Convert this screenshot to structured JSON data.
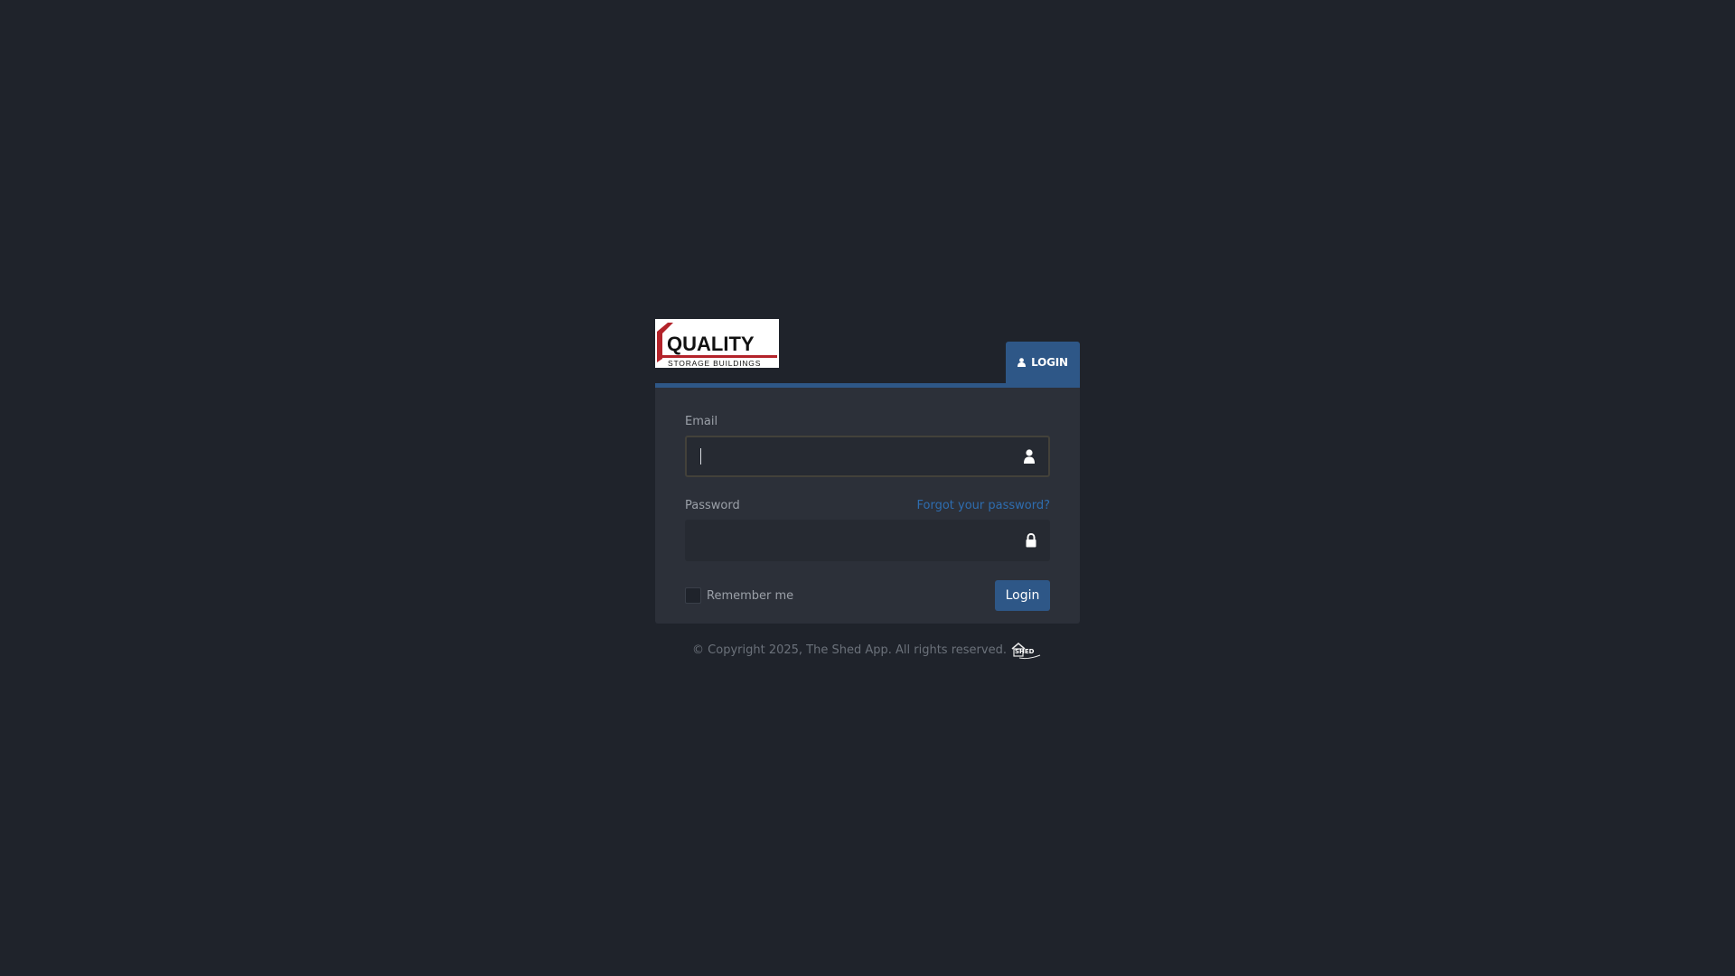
{
  "logo": {
    "line1": "QUALITY",
    "line2": "STORAGE BUILDINGS"
  },
  "tab": {
    "label": "LOGIN",
    "icon": "user-icon"
  },
  "form": {
    "email_label": "Email",
    "email_value": "",
    "email_icon": "user-icon",
    "password_label": "Password",
    "forgot_link": "Forgot your password?",
    "password_value": "",
    "password_icon": "lock-icon",
    "remember_label": "Remember me",
    "remember_checked": false,
    "submit_label": "Login"
  },
  "footer": {
    "copyright": "© Copyright 2025, The Shed App. All rights reserved.",
    "badge_text": "SHED"
  },
  "colors": {
    "background": "#1f232b",
    "panel": "#2c3039",
    "accent": "#2e5787",
    "link": "#2e6db0",
    "logo_red": "#b3232a"
  }
}
